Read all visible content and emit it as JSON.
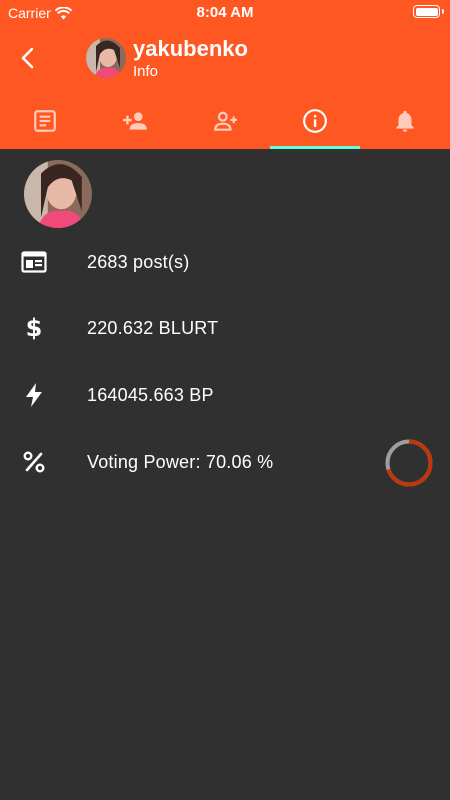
{
  "status_bar": {
    "carrier": "Carrier",
    "time": "8:04 AM"
  },
  "header": {
    "title": "yakubenko",
    "subtitle": "Info",
    "background": "#ff5722"
  },
  "tabs": [
    {
      "name": "posts",
      "icon": "article-icon"
    },
    {
      "name": "followers",
      "icon": "person-add-icon"
    },
    {
      "name": "following",
      "icon": "person-add-outline-icon"
    },
    {
      "name": "info",
      "icon": "info-icon",
      "active": true
    },
    {
      "name": "notifications",
      "icon": "bell-icon"
    }
  ],
  "active_tab_indicator_color": "#64ffda",
  "info": {
    "posts": "2683 post(s)",
    "balance": "220.632 BLURT",
    "power": "164045.663 BP",
    "voting_power": "Voting Power: 70.06 %",
    "voting_power_value": 70.06
  }
}
